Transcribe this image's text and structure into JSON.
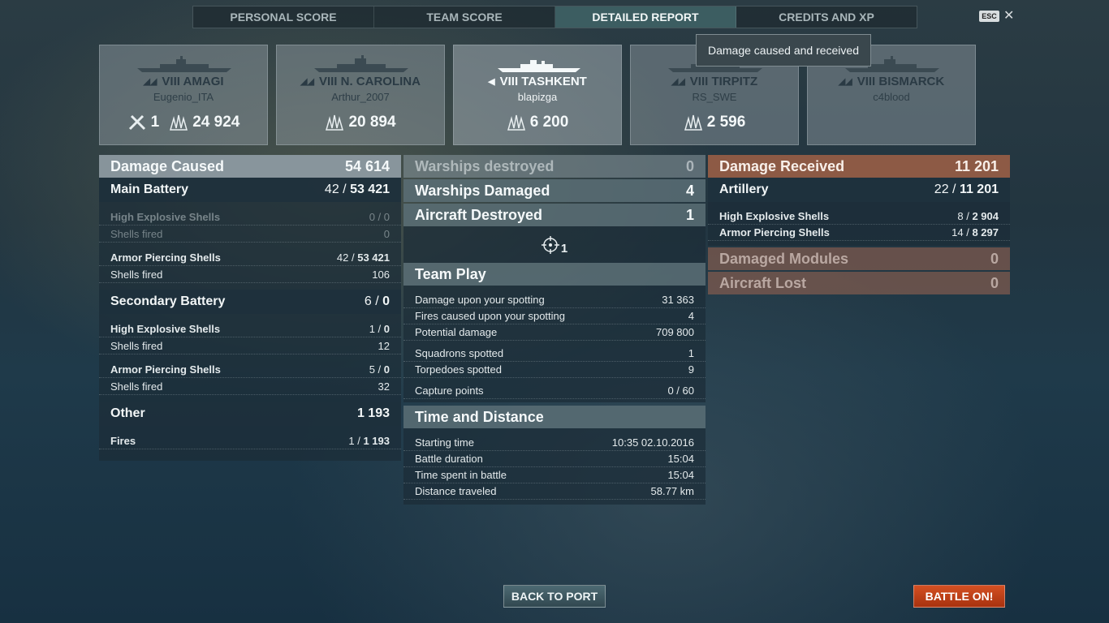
{
  "tabs": [
    {
      "label": "PERSONAL SCORE",
      "active": false
    },
    {
      "label": "TEAM SCORE",
      "active": false
    },
    {
      "label": "DETAILED REPORT",
      "active": true
    },
    {
      "label": "CREDITS AND XP",
      "active": false
    }
  ],
  "esc_label": "ESC",
  "close_glyph": "✕",
  "tooltip": "Damage caused and received",
  "ships": [
    {
      "tier": "VIII",
      "name": "AMAGI",
      "player": "Eugenio_ITA",
      "kills": "1",
      "damage": "24 924"
    },
    {
      "tier": "VIII",
      "name": "N. CAROLINA",
      "player": "Arthur_2007",
      "damage": "20 894"
    },
    {
      "tier": "VIII",
      "name": "TASHKENT",
      "player": "blapizga",
      "damage": "6 200"
    },
    {
      "tier": "VIII",
      "name": "TIRPITZ",
      "player": "RS_SWE",
      "damage": "2 596"
    },
    {
      "tier": "VIII",
      "name": "BISMARCK",
      "player": "c4blood"
    }
  ],
  "caused": {
    "title": "Damage Caused",
    "total": "54 614",
    "main": {
      "label": "Main Battery",
      "hits": "42",
      "dmg": "53 421",
      "he": {
        "label": "High Explosive Shells",
        "hits": "0",
        "dmg": "0",
        "fired_label": "Shells fired",
        "fired": "0"
      },
      "ap": {
        "label": "Armor Piercing Shells",
        "hits": "42",
        "dmg": "53 421",
        "fired_label": "Shells fired",
        "fired": "106"
      }
    },
    "secondary": {
      "label": "Secondary Battery",
      "hits": "6",
      "dmg": "0",
      "he": {
        "label": "High Explosive Shells",
        "hits": "1",
        "dmg": "0",
        "fired_label": "Shells fired",
        "fired": "12"
      },
      "ap": {
        "label": "Armor Piercing Shells",
        "hits": "5",
        "dmg": "0",
        "fired_label": "Shells fired",
        "fired": "32"
      }
    },
    "other": {
      "label": "Other",
      "total": "1 193",
      "fires_label": "Fires",
      "fires_hits": "1",
      "fires_dmg": "1 193"
    }
  },
  "middle": {
    "destroyed_label": "Warships destroyed",
    "destroyed": "0",
    "damaged_label": "Warships Damaged",
    "damaged": "4",
    "aircraft_label": "Aircraft Destroyed",
    "aircraft": "1",
    "aircraft_icon_count": "1",
    "teamplay": {
      "title": "Team Play",
      "rows": [
        {
          "label": "Damage upon your spotting",
          "value": "31 363"
        },
        {
          "label": "Fires caused upon your spotting",
          "value": "4"
        },
        {
          "label": "Potential damage",
          "value": "709 800"
        },
        {
          "label": "Squadrons spotted",
          "value": "1"
        },
        {
          "label": "Torpedoes spotted",
          "value": "9"
        },
        {
          "label": "Capture points",
          "value": "0 / 60"
        }
      ]
    },
    "time": {
      "title": "Time and Distance",
      "rows": [
        {
          "label": "Starting time",
          "value": "10:35  02.10.2016"
        },
        {
          "label": "Battle duration",
          "value": "15:04"
        },
        {
          "label": "Time spent in battle",
          "value": "15:04"
        },
        {
          "label": "Distance traveled",
          "value": "58.77 km"
        }
      ]
    }
  },
  "received": {
    "title": "Damage Received",
    "total": "11 201",
    "artillery": {
      "label": "Artillery",
      "hits": "22",
      "dmg": "11 201"
    },
    "he": {
      "label": "High Explosive Shells",
      "hits": "8",
      "dmg": "2 904"
    },
    "ap": {
      "label": "Armor Piercing Shells",
      "hits": "14",
      "dmg": "8 297"
    },
    "modules_label": "Damaged Modules",
    "modules": "0",
    "aircraft_lost_label": "Aircraft Lost",
    "aircraft_lost": "0"
  },
  "buttons": {
    "port": "BACK TO PORT",
    "battle": "BATTLE ON!"
  },
  "colors": {
    "accent_teal": "#466e70",
    "received_brown": "#a0604a",
    "battle_orange": "#d45022"
  }
}
